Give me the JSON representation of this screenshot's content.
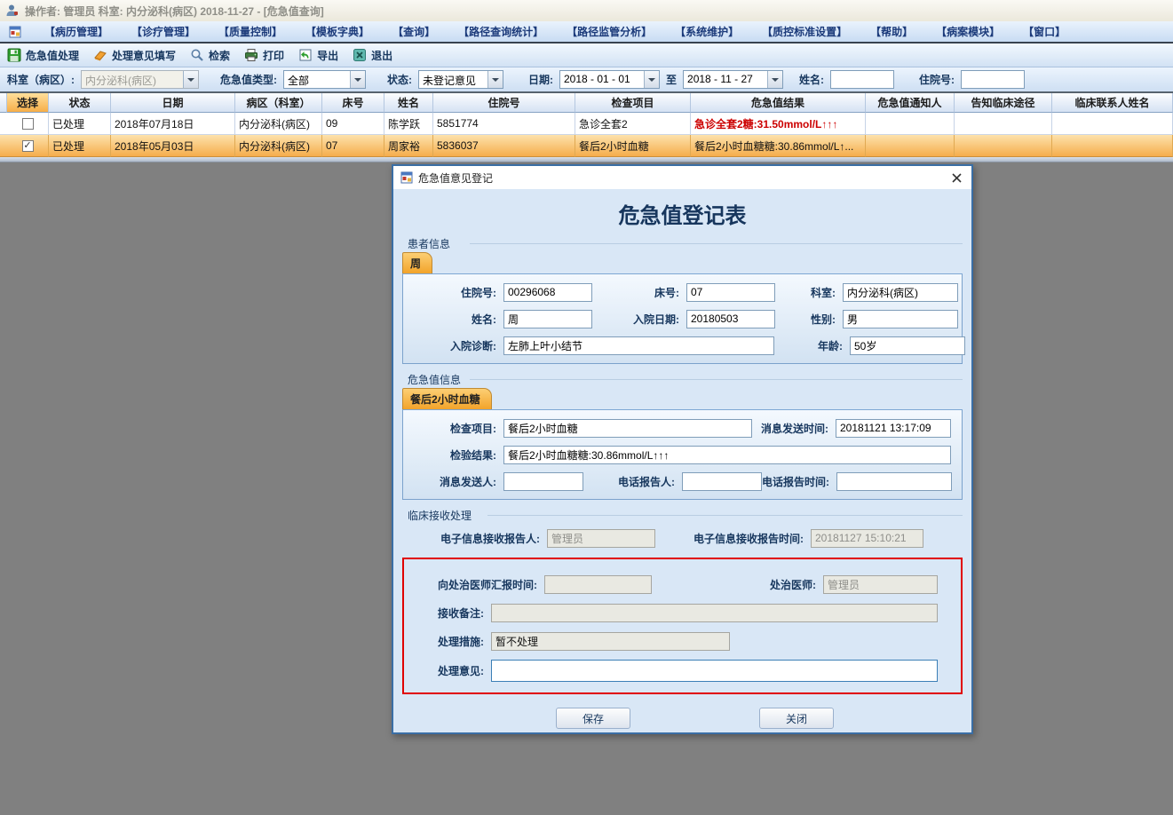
{
  "window": {
    "title": "操作者: 管理员  科室: 内分泌科(病区)  2018-11-27 - [危急值查询]"
  },
  "menu": {
    "items": [
      "【病历管理】",
      "【诊疗管理】",
      "【质量控制】",
      "【模板字典】",
      "【查询】",
      "【路径查询统计】",
      "【路径监管分析】",
      "【系统维护】",
      "【质控标准设置】",
      "【帮助】",
      "【病案模块】",
      "【窗口】"
    ]
  },
  "toolbar": {
    "items": [
      {
        "label": "危急值处理",
        "icon": "save-icon"
      },
      {
        "label": "处理意见填写",
        "icon": "eraser-icon"
      },
      {
        "label": "检索",
        "icon": "search-icon"
      },
      {
        "label": "打印",
        "icon": "printer-icon"
      },
      {
        "label": "导出",
        "icon": "export-icon"
      },
      {
        "label": "退出",
        "icon": "exit-icon"
      }
    ]
  },
  "filters": {
    "dept_label": "科室（病区）:",
    "dept_value": "内分泌科(病区)",
    "type_label": "危急值类型:",
    "type_value": "全部",
    "status_label": "状态:",
    "status_value": "未登记意见",
    "date_label": "日期:",
    "date_from": "2018 - 01 - 01",
    "to_label": "至",
    "date_to": "2018 - 11 - 27",
    "name_label": "姓名:",
    "name_value": "",
    "admission_label": "住院号:",
    "admission_value": ""
  },
  "table": {
    "columns": [
      "选择",
      "状态",
      "日期",
      "病区（科室）",
      "床号",
      "姓名",
      "住院号",
      "检查项目",
      "危急值结果",
      "危急值通知人",
      "告知临床途径",
      "临床联系人姓名"
    ],
    "rows": [
      {
        "check": "",
        "status": "已处理",
        "date": "2018年07月18日",
        "ward": "内分泌科(病区)",
        "bed": "09",
        "name": "陈学跃",
        "admission_no": "5851774",
        "exam": "急诊全套2",
        "result": "急诊全套2糖:31.50mmol/L↑↑↑",
        "notify_person": "",
        "notify_channel": "",
        "contact_name": ""
      },
      {
        "check": "✓",
        "status": "已处理",
        "date": "2018年05月03日",
        "ward": "内分泌科(病区)",
        "bed": "07",
        "name": "周家裕",
        "admission_no": "5836037",
        "exam": "餐后2小时血糖",
        "result": "餐后2小时血糖糖:30.86mmol/L↑...",
        "notify_person": "",
        "notify_channel": "",
        "contact_name": ""
      }
    ]
  },
  "dialog": {
    "title": "危急值意见登记",
    "heading": "危急值登记表",
    "patient": {
      "section_label": "患者信息",
      "tab": "周",
      "admission_label": "住院号:",
      "admission_value": "00296068",
      "bed_label": "床号:",
      "bed_value": "07",
      "dept_label": "科室:",
      "dept_value": "内分泌科(病区)",
      "name_label": "姓名:",
      "name_value": "周",
      "admit_date_label": "入院日期:",
      "admit_date_value": "20180503",
      "gender_label": "性别:",
      "gender_value": "男",
      "diagnosis_label": "入院诊断:",
      "diagnosis_value": "左肺上叶小结节",
      "age_label": "年龄:",
      "age_value": "50岁"
    },
    "critical": {
      "section_label": "危急值信息",
      "tab": "餐后2小时血糖",
      "exam_label": "检查项目:",
      "exam_value": "餐后2小时血糖",
      "msg_time_label": "消息发送时间:",
      "msg_time_value": "20181121 13:17:09",
      "result_label": "检验结果:",
      "result_value": "餐后2小时血糖糖:30.86mmol/L↑↑↑",
      "sender_label": "消息发送人:",
      "sender_value": "",
      "phone_reporter_label": "电话报告人:",
      "phone_reporter_value": "",
      "phone_time_label": "电话报告时间:",
      "phone_time_value": ""
    },
    "clinical": {
      "section_label": "临床接收处理",
      "receiver_label": "电子信息接收报告人:",
      "receiver_value": "管理员",
      "receive_time_label": "电子信息接收报告时间:",
      "receive_time_value": "20181127 15:10:21",
      "report_time_label": "向处治医师汇报时间:",
      "report_time_value": "",
      "doctor_label": "处治医师:",
      "doctor_value": "管理员",
      "remark_label": "接收备注:",
      "remark_value": "",
      "measure_label": "处理措施:",
      "measure_value": "暂不处理",
      "opinion_label": "处理意见:",
      "opinion_value": ""
    },
    "buttons": {
      "save": "保存",
      "close": "关闭"
    }
  },
  "ui_colors": {
    "critical_text": "#cc0000",
    "row_highlight": "#f5ad4c",
    "tab_accent": "#f2a32a",
    "attention_border": "#e00000",
    "dialog_border": "#3a6ea5"
  }
}
